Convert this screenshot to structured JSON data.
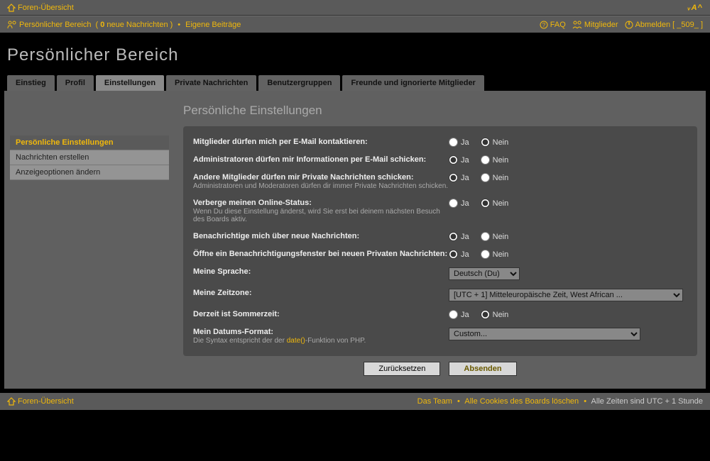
{
  "header": {
    "forum_index": "Foren-Übersicht",
    "font_toggle": "ᵥA^"
  },
  "navbar": {
    "personal_area": "Persönlicher Bereich",
    "new_msg_count": "0",
    "new_msg_text": " neue Nachrichten",
    "own_posts": "Eigene Beiträge",
    "faq": "FAQ",
    "members": "Mitglieder",
    "logout": "Abmelden [ _509_ ]"
  },
  "page_title": "Persönlicher Bereich",
  "tabs": [
    {
      "label": "Einstieg"
    },
    {
      "label": "Profil"
    },
    {
      "label": "Einstellungen"
    },
    {
      "label": "Private Nachrichten"
    },
    {
      "label": "Benutzergruppen"
    },
    {
      "label": "Freunde und ignorierte Mitglieder"
    }
  ],
  "side": [
    {
      "label": "Persönliche Einstellungen"
    },
    {
      "label": "Nachrichten erstellen"
    },
    {
      "label": "Anzeigeoptionen ändern"
    }
  ],
  "panel_title": "Persönliche Einstellungen",
  "yes": "Ja",
  "no": "Nein",
  "rows": {
    "r0": {
      "label": "Mitglieder dürfen mich per E-Mail kontaktieren:"
    },
    "r1": {
      "label": "Administratoren dürfen mir Informationen per E-Mail schicken:"
    },
    "r2": {
      "label": "Andere Mitglieder dürfen mir Private Nachrichten schicken:",
      "hint": "Administratoren und Moderatoren dürfen dir immer Private Nachrichten schicken."
    },
    "r3": {
      "label": "Verberge meinen Online-Status:",
      "hint": "Wenn Du diese Einstellung änderst, wird Sie erst bei deinem nächsten Besuch des Boards aktiv."
    },
    "r4": {
      "label": "Benachrichtige mich über neue Nachrichten:"
    },
    "r5": {
      "label": "Öffne ein Benachrichtigungsfenster bei neuen Privaten Nachrichten:"
    },
    "r6": {
      "label": "Meine Sprache:"
    },
    "r7": {
      "label": "Meine Zeitzone:"
    },
    "r8": {
      "label": "Derzeit ist Sommerzeit:"
    },
    "r9": {
      "label": "Mein Datums-Format:",
      "hint_pre": "Die Syntax entspricht der der ",
      "hint_link": "date()",
      "hint_post": "-Funktion von PHP."
    }
  },
  "lang_option": "Deutsch (Du)",
  "tz_option": "[UTC + 1] Mitteleuropäische Zeit, West African ...",
  "date_option": "Custom...",
  "reset": "Zurücksetzen",
  "submit": "Absenden",
  "footer": {
    "forum_index": "Foren-Übersicht",
    "team": "Das Team",
    "cookies": "Alle Cookies des Boards löschen",
    "tz": "Alle Zeiten sind UTC + 1 Stunde"
  }
}
